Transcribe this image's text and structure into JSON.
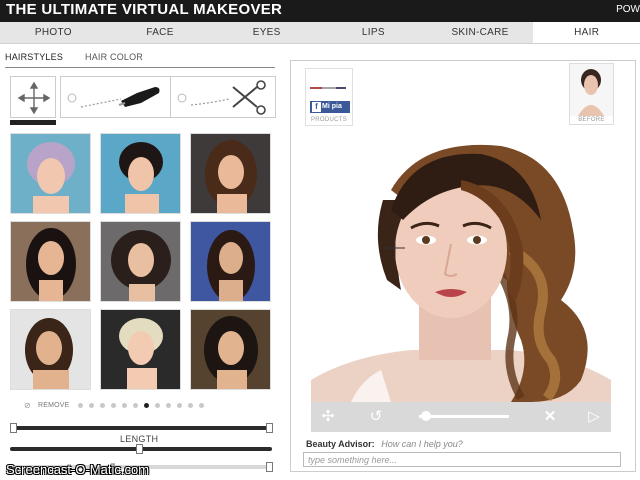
{
  "header": {
    "title": "THE ULTIMATE VIRTUAL MAKEOVER",
    "right_text": "POW"
  },
  "tabs": [
    {
      "label": "PHOTO",
      "active": false
    },
    {
      "label": "FACE",
      "active": false
    },
    {
      "label": "EYES",
      "active": false
    },
    {
      "label": "LIPS",
      "active": false
    },
    {
      "label": "SKIN-CARE",
      "active": false
    },
    {
      "label": "HAIR",
      "active": true
    }
  ],
  "left_panel": {
    "subtabs": [
      {
        "label": "HAIRSTYLES",
        "active": true
      },
      {
        "label": "HAIR COLOR",
        "active": false
      }
    ],
    "tools": [
      "move-icon",
      "brush-icon",
      "scissors-icon"
    ],
    "pager": {
      "remove_label": "REMOVE",
      "dot_count": 12,
      "current_dot": 6
    },
    "length_label": "LENGTH"
  },
  "thumbnails": [
    {
      "hair": "#b8a4c8",
      "bg": "#6fb0c9",
      "skin": "#f1c7b0"
    },
    {
      "hair": "#1e1614",
      "bg": "#5ba7c8",
      "skin": "#f0c4a8"
    },
    {
      "hair": "#4a2a18",
      "bg": "#3e3a3a",
      "skin": "#e9b99a"
    },
    {
      "hair": "#1a1210",
      "bg": "#8a6f5a",
      "skin": "#e6b594"
    },
    {
      "hair": "#2a1f1a",
      "bg": "#6c6a6a",
      "skin": "#e8bfa0"
    },
    {
      "hair": "#2b1a14",
      "bg": "#3f57a0",
      "skin": "#dcae8c"
    },
    {
      "hair": "#3b2418",
      "bg": "#e4e4e4",
      "skin": "#e2b28e"
    },
    {
      "hair": "#e4dcc0",
      "bg": "#2a2a2a",
      "skin": "#f2cbb2"
    },
    {
      "hair": "#1c1512",
      "bg": "#55422f",
      "skin": "#e1b38f"
    }
  ],
  "stage": {
    "products_label": "PRODUCTS",
    "fb_label": "Mi pia",
    "before_label": "BEFORE",
    "controls": [
      "rotate-icon",
      "undo-icon",
      "close-icon",
      "play-icon"
    ]
  },
  "advisor": {
    "label": "Beauty Advisor:",
    "message": "How can I help you?",
    "placeholder": "type something here..."
  },
  "watermark": "Screencast-O-Matic.com",
  "colors": {
    "topbar": "#1a1a1a",
    "tabbar": "#e6e6e6",
    "facebook": "#3b5998"
  }
}
